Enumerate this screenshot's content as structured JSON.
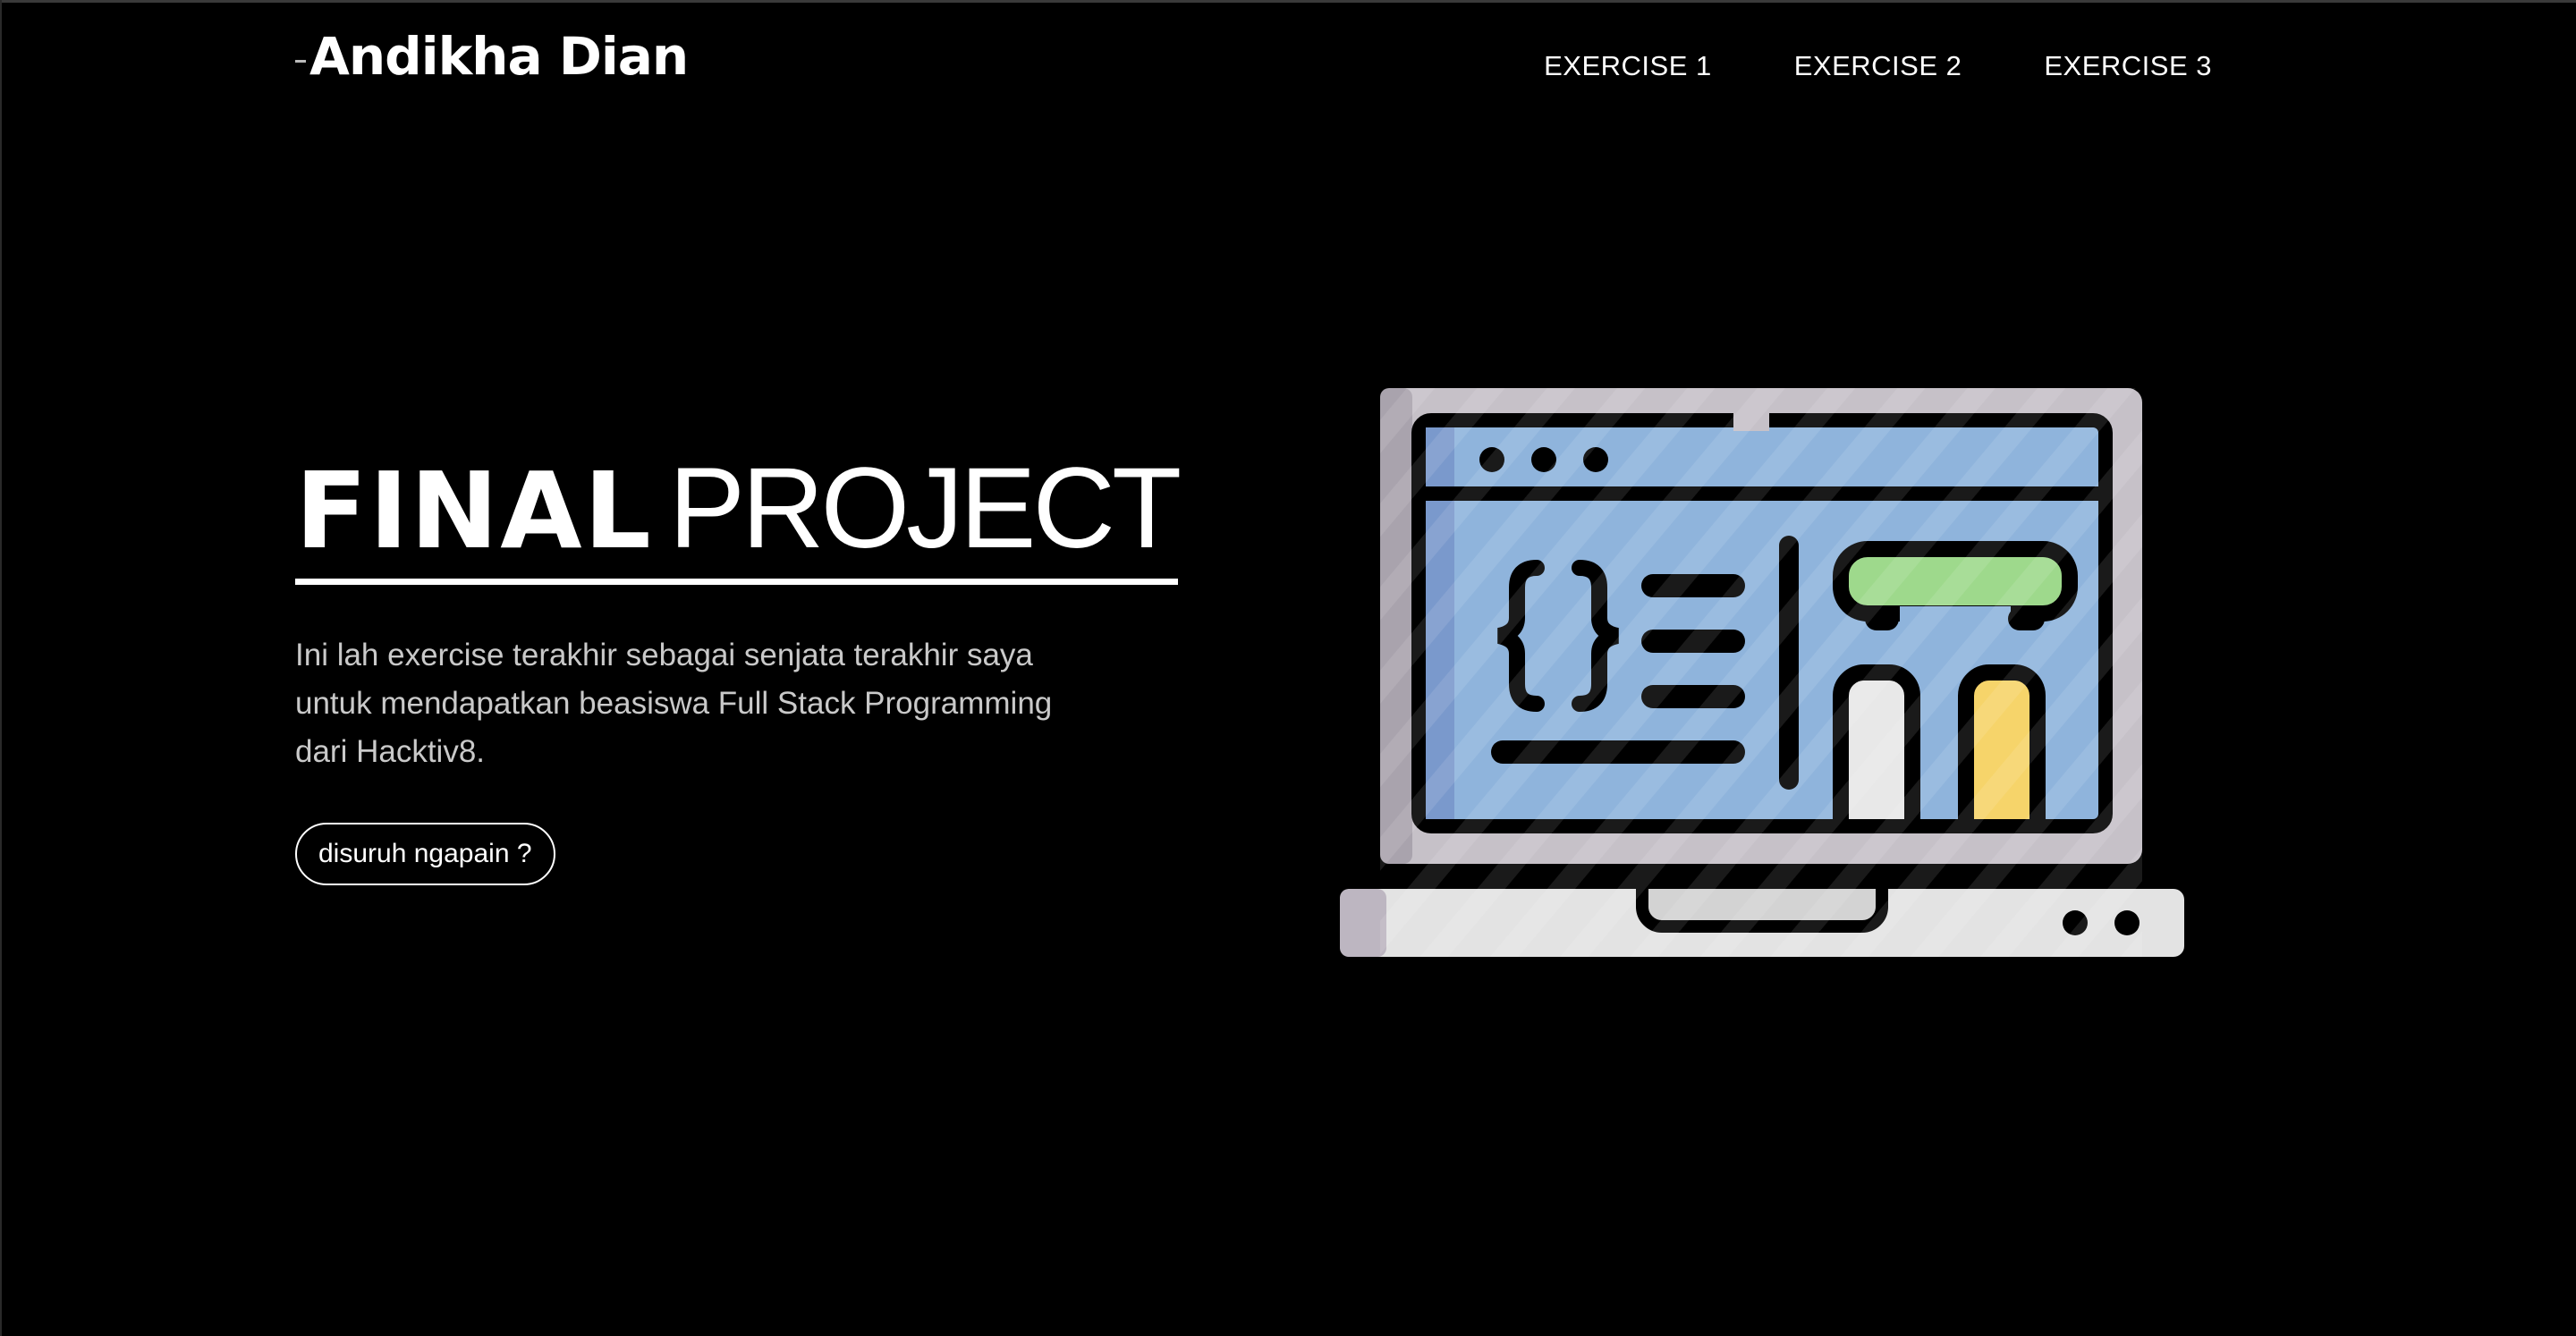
{
  "navbar": {
    "brand": "Andikha Dian",
    "links": [
      {
        "label": "EXERCISE 1"
      },
      {
        "label": "EXERCISE 2"
      },
      {
        "label": "EXERCISE 3"
      }
    ]
  },
  "hero": {
    "title_bold": "FINAL",
    "title_light": "PROJECT",
    "description": "Ini lah exercise terakhir sebagai senjata terakhir saya untuk mendapatkan beasiswa Full Stack Programming dari Hacktiv8.",
    "button_label": "disuruh ngapain ?"
  },
  "illustration": {
    "icon": "laptop-code-icon",
    "colors": {
      "frame": "#c6c1c8",
      "screen": "#8fb4dc",
      "accent_green": "#9ed98c",
      "accent_yellow": "#f6d46a",
      "accent_white": "#e8e8e8",
      "outline": "#000000"
    }
  }
}
